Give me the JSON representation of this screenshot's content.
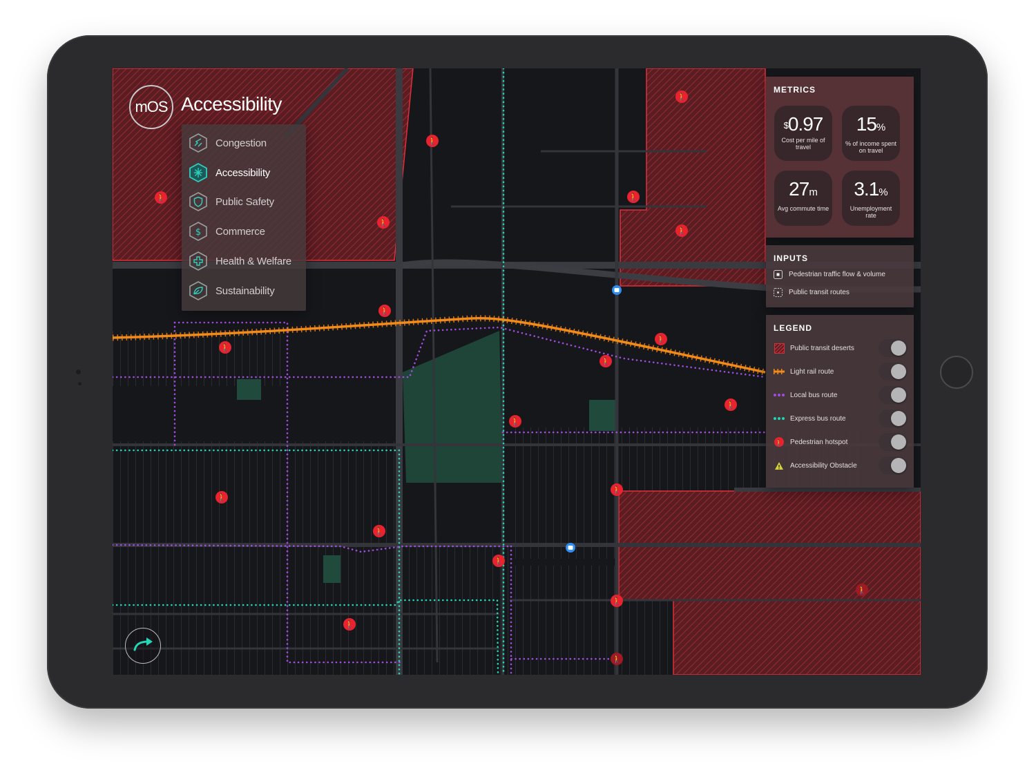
{
  "app": {
    "brand": "mOS",
    "title": "Accessibility"
  },
  "menu": {
    "items": [
      {
        "label": "Congestion",
        "icon": "congestion-icon",
        "active": false
      },
      {
        "label": "Accessibility",
        "icon": "accessibility-icon",
        "active": true
      },
      {
        "label": "Public Safety",
        "icon": "shield-icon",
        "active": false
      },
      {
        "label": "Commerce",
        "icon": "dollar-icon",
        "active": false
      },
      {
        "label": "Health & Welfare",
        "icon": "medical-cross-icon",
        "active": false
      },
      {
        "label": "Sustainability",
        "icon": "leaf-icon",
        "active": false
      }
    ]
  },
  "metrics": {
    "title": "METRICS",
    "cost": {
      "prefix": "$",
      "value": "0.97",
      "caption": "Cost per mile of travel"
    },
    "income": {
      "value": "15",
      "suffix": "%",
      "caption": "% of income spent on travel"
    },
    "commute": {
      "value": "27",
      "suffix": "m",
      "caption": "Avg commute time"
    },
    "unemployment": {
      "value": "3.1",
      "suffix": "%",
      "caption": "Unemployment rate"
    }
  },
  "inputs": {
    "title": "INPUTS",
    "items": [
      {
        "label": "Pedestrian traffic flow & volume",
        "icon": "pedestrian-flow-icon"
      },
      {
        "label": "Public transit routes",
        "icon": "transit-routes-icon"
      }
    ]
  },
  "legend": {
    "title": "LEGEND",
    "items": [
      {
        "label": "Public transit deserts",
        "icon": "hatch-swatch-icon",
        "enabled": true
      },
      {
        "label": "Light rail route",
        "icon": "light-rail-icon",
        "enabled": true
      },
      {
        "label": "Local bus route",
        "icon": "local-bus-icon",
        "enabled": true
      },
      {
        "label": "Express bus route",
        "icon": "express-bus-icon",
        "enabled": true
      },
      {
        "label": "Pedestrian hotspot",
        "icon": "pedestrian-icon",
        "enabled": true
      },
      {
        "label": "Accessibility Obstacle",
        "icon": "warning-triangle-icon",
        "enabled": true
      }
    ]
  },
  "colors": {
    "desert": "#e0303a",
    "light_rail": "#f28a1a",
    "local_bus": "#a24ce0",
    "express_bus": "#22d6b8",
    "pedestrian": "#e8232f",
    "obstacle": "#d6d23a",
    "bus_stop": "#2e8ff0"
  }
}
